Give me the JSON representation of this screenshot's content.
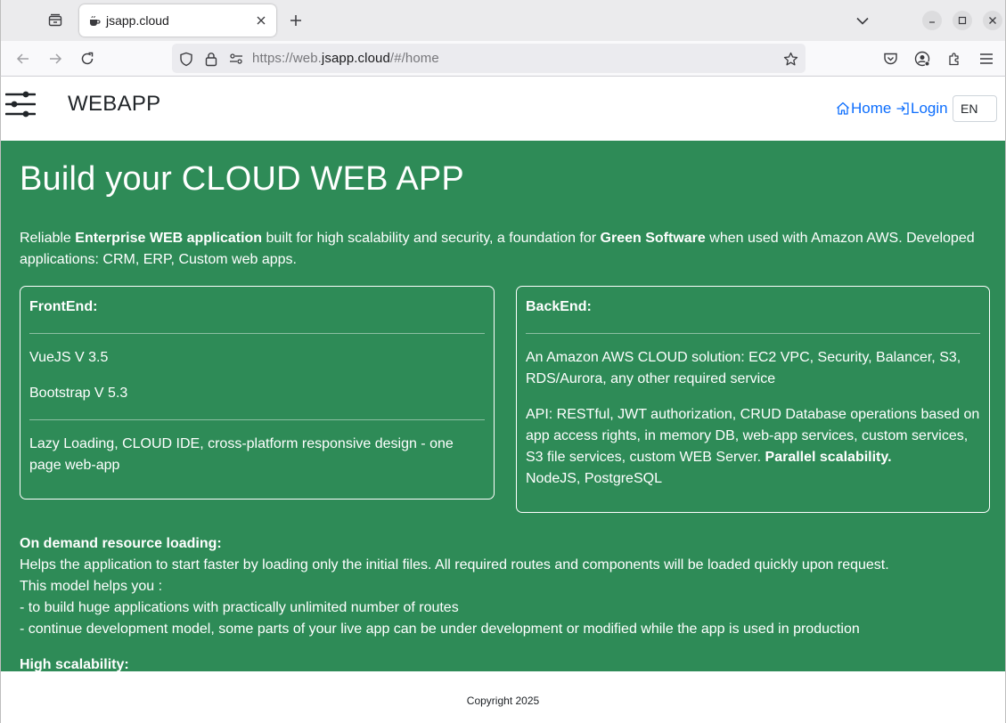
{
  "browser": {
    "tab_title": "jsapp.cloud",
    "url_prefix": "https://web.",
    "url_domain": "jsapp.cloud",
    "url_path": "/#/home"
  },
  "site": {
    "brand": "WEBAPP",
    "nav_home": "Home",
    "nav_login": "Login",
    "language": "EN"
  },
  "hero": {
    "title": "Build your CLOUD WEB APP",
    "intro": {
      "t1": "Reliable ",
      "b1": "Enterprise WEB application",
      "t2": " built for high scalability and security, a foundation for ",
      "b2": "Green Software",
      "t3": " when used with Amazon AWS. Developed applications: CRM, ERP, Custom web apps."
    }
  },
  "frontend": {
    "title": "FrontEnd:",
    "items": [
      "VueJS V 3.5",
      "Bootstrap V 5.3"
    ],
    "note": "Lazy Loading, CLOUD IDE, cross-platform responsive design - one page web-app"
  },
  "backend": {
    "title": "BackEnd:",
    "aws": "An Amazon AWS CLOUD solution: EC2 VPC, Security, Balancer, S3, RDS/Aurora, any other required service",
    "api": "API: RESTful, JWT authorization, CRUD Database operations based on app access rights, in memory DB, web-app services, custom services, S3 file services, custom WEB Server. ",
    "api_bold": "Parallel scalability.",
    "stack": "NodeJS, PostgreSQL"
  },
  "on_demand": {
    "title": "On demand resource loading:",
    "lines": [
      "Helps the application to start faster by loading only the initial files. All required routes and components will be loaded quickly upon request.",
      "This model helps you :",
      "- to build huge applications with practically unlimited number of routes",
      "- continue development model, some parts of your live app can be under development or modified while the app is used in production"
    ]
  },
  "scalability": {
    "title": "High scalability:"
  },
  "footer": {
    "copyright": "Copyright 2025"
  },
  "colors": {
    "hero_bg": "#2e8b57",
    "link": "#0d6efd"
  },
  "icons": [
    "tab-list-icon",
    "favicon-icon",
    "close-icon",
    "plus-icon",
    "chevron-down-icon",
    "minimize-icon",
    "maximize-icon",
    "back-icon",
    "forward-icon",
    "reload-icon",
    "shield-icon",
    "lock-icon",
    "permissions-icon",
    "star-icon",
    "pocket-icon",
    "account-icon",
    "extensions-icon",
    "hamburger-icon",
    "sliders-icon",
    "home-icon",
    "login-icon"
  ]
}
